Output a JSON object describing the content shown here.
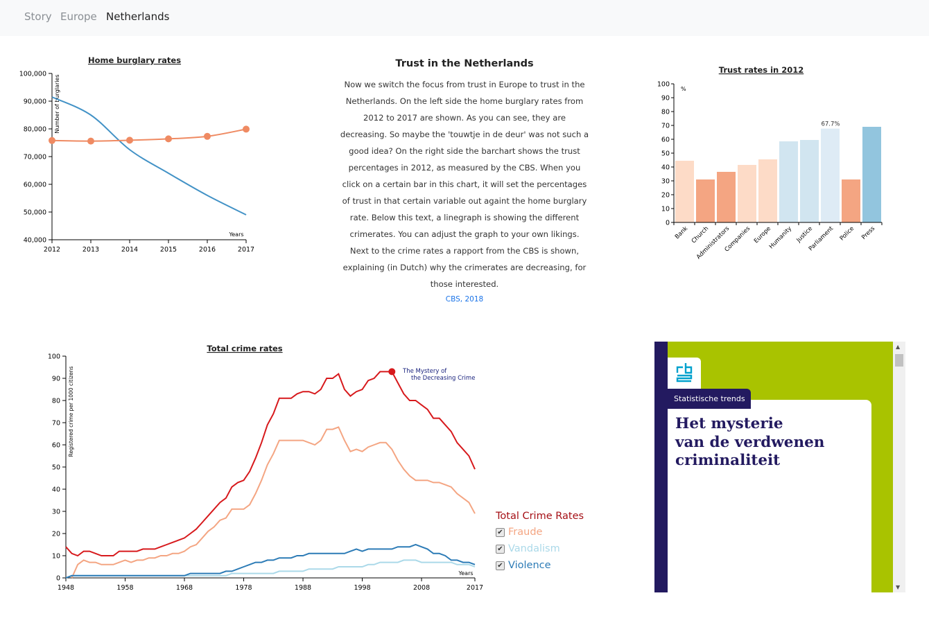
{
  "nav": {
    "items": [
      {
        "label": "Story"
      },
      {
        "label": "Europe"
      },
      {
        "label": "Netherlands"
      }
    ]
  },
  "intro": {
    "title": "Trust in the Netherlands",
    "text": "Now we switch the focus from trust in Europe to trust in the Netherlands. On the left side the home burglary rates from 2012 to 2017 are shown. As you can see, they are decreasing. So maybe the 'touwtje in de deur' was not such a good idea? On the right side the barchart shows the trust percentages in 2012, as measured by the CBS. When you click on a certain bar in this chart, it will set the percentages of trust in that certain variable out againt the home burglary rate. Below this text, a linegraph is showing the different crimerates. You can adjust the graph to your own likings. Next to the crime rates a rapport from the CBS is shown, explaining (in Dutch) why the crimerates are decreasing, for those interested.",
    "link": "CBS, 2018"
  },
  "chart_data": [
    {
      "type": "line",
      "title": "Home burglary rates",
      "ylabel": "Number of burglaries",
      "xlabel": "Years",
      "x": [
        2012,
        2013,
        2014,
        2015,
        2016,
        2017
      ],
      "xticks": [
        "2012",
        "2013",
        "2014",
        "2015",
        "2016",
        "2017"
      ],
      "yticks": [
        "40,000",
        "50,000",
        "60,000",
        "70,000",
        "80,000",
        "90,000",
        "100,000"
      ],
      "ylim": [
        40000,
        100000
      ],
      "series": [
        {
          "values": [
            91500,
            85000,
            72500,
            64000,
            56000,
            49000
          ],
          "color": "#4292c6",
          "markers": false
        },
        {
          "values": [
            75800,
            75600,
            75900,
            76400,
            77300,
            79900
          ],
          "color": "#ef8a62",
          "markers": true
        }
      ]
    },
    {
      "type": "bar",
      "title": "Trust rates in 2012",
      "ylabel": "%",
      "categories": [
        "Bank",
        "Church",
        "Administrators",
        "Companies",
        "Europe",
        "Humanity",
        "Justice",
        "Parliament",
        "Police",
        "Press"
      ],
      "values": [
        44.5,
        31,
        36.5,
        41.5,
        45.5,
        58.5,
        59.5,
        67.7,
        31,
        69
      ],
      "colors": [
        "#fddbc7",
        "#f4a582",
        "#f4a582",
        "#fddbc7",
        "#fddbc7",
        "#d1e5f0",
        "#d1e5f0",
        "#deebf5",
        "#f4a582",
        "#92c5de"
      ],
      "highlight_label": "67.7%",
      "highlight_index": 7,
      "yticks": [
        "0",
        "10",
        "20",
        "30",
        "40",
        "50",
        "60",
        "70",
        "80",
        "90",
        "100"
      ],
      "ylim": [
        0,
        100
      ]
    },
    {
      "type": "line",
      "title": "Total crime rates",
      "ylabel": "Registered crime per 1000 citizens",
      "xlabel": "Years",
      "xlim": [
        1948,
        2017
      ],
      "ylim": [
        0,
        100
      ],
      "xticks": [
        "1948",
        "1958",
        "1968",
        "1978",
        "1988",
        "1998",
        "2008",
        "2017"
      ],
      "yticks": [
        "0",
        "10",
        "20",
        "30",
        "40",
        "50",
        "60",
        "70",
        "80",
        "90",
        "100"
      ],
      "annotation": {
        "line1": "The Mystery of",
        "line2": "the Decreasing Crime",
        "x": 2003,
        "y": 93
      },
      "legend_title": "Total Crime Rates",
      "series": [
        {
          "name": "Total",
          "color": "#d7191c",
          "points": [
            [
              1948,
              14
            ],
            [
              1949,
              11
            ],
            [
              1950,
              10
            ],
            [
              1951,
              12
            ],
            [
              1952,
              12
            ],
            [
              1953,
              11
            ],
            [
              1954,
              10
            ],
            [
              1955,
              10
            ],
            [
              1956,
              10
            ],
            [
              1957,
              12
            ],
            [
              1958,
              12
            ],
            [
              1959,
              12
            ],
            [
              1960,
              12
            ],
            [
              1961,
              13
            ],
            [
              1962,
              13
            ],
            [
              1963,
              13
            ],
            [
              1964,
              14
            ],
            [
              1965,
              15
            ],
            [
              1966,
              16
            ],
            [
              1967,
              17
            ],
            [
              1968,
              18
            ],
            [
              1969,
              20
            ],
            [
              1970,
              22
            ],
            [
              1971,
              25
            ],
            [
              1972,
              28
            ],
            [
              1973,
              31
            ],
            [
              1974,
              34
            ],
            [
              1975,
              36
            ],
            [
              1976,
              41
            ],
            [
              1977,
              43
            ],
            [
              1978,
              44
            ],
            [
              1979,
              48
            ],
            [
              1980,
              54
            ],
            [
              1981,
              61
            ],
            [
              1982,
              69
            ],
            [
              1983,
              74
            ],
            [
              1984,
              81
            ],
            [
              1985,
              81
            ],
            [
              1986,
              81
            ],
            [
              1987,
              83
            ],
            [
              1988,
              84
            ],
            [
              1989,
              84
            ],
            [
              1990,
              83
            ],
            [
              1991,
              85
            ],
            [
              1992,
              90
            ],
            [
              1993,
              90
            ],
            [
              1994,
              92
            ],
            [
              1995,
              85
            ],
            [
              1996,
              82
            ],
            [
              1997,
              84
            ],
            [
              1998,
              85
            ],
            [
              1999,
              89
            ],
            [
              2000,
              90
            ],
            [
              2001,
              93
            ],
            [
              2002,
              93
            ],
            [
              2003,
              93
            ],
            [
              2004,
              88
            ],
            [
              2005,
              83
            ],
            [
              2006,
              80
            ],
            [
              2007,
              80
            ],
            [
              2008,
              78
            ],
            [
              2009,
              76
            ],
            [
              2010,
              72
            ],
            [
              2011,
              72
            ],
            [
              2012,
              69
            ],
            [
              2013,
              66
            ],
            [
              2014,
              61
            ],
            [
              2015,
              58
            ],
            [
              2016,
              55
            ],
            [
              2017,
              49
            ]
          ]
        },
        {
          "name": "Fraude",
          "color": "#f4a582",
          "checked": true,
          "points": [
            [
              1949,
              0
            ],
            [
              1950,
              6
            ],
            [
              1951,
              8
            ],
            [
              1952,
              7
            ],
            [
              1953,
              7
            ],
            [
              1954,
              6
            ],
            [
              1955,
              6
            ],
            [
              1956,
              6
            ],
            [
              1957,
              7
            ],
            [
              1958,
              8
            ],
            [
              1959,
              7
            ],
            [
              1960,
              8
            ],
            [
              1961,
              8
            ],
            [
              1962,
              9
            ],
            [
              1963,
              9
            ],
            [
              1964,
              10
            ],
            [
              1965,
              10
            ],
            [
              1966,
              11
            ],
            [
              1967,
              11
            ],
            [
              1968,
              12
            ],
            [
              1969,
              14
            ],
            [
              1970,
              15
            ],
            [
              1971,
              18
            ],
            [
              1972,
              21
            ],
            [
              1973,
              23
            ],
            [
              1974,
              26
            ],
            [
              1975,
              27
            ],
            [
              1976,
              31
            ],
            [
              1977,
              31
            ],
            [
              1978,
              31
            ],
            [
              1979,
              33
            ],
            [
              1980,
              38
            ],
            [
              1981,
              44
            ],
            [
              1982,
              51
            ],
            [
              1983,
              56
            ],
            [
              1984,
              62
            ],
            [
              1985,
              62
            ],
            [
              1986,
              62
            ],
            [
              1987,
              62
            ],
            [
              1988,
              62
            ],
            [
              1989,
              61
            ],
            [
              1990,
              60
            ],
            [
              1991,
              62
            ],
            [
              1992,
              67
            ],
            [
              1993,
              67
            ],
            [
              1994,
              68
            ],
            [
              1995,
              62
            ],
            [
              1996,
              57
            ],
            [
              1997,
              58
            ],
            [
              1998,
              57
            ],
            [
              1999,
              59
            ],
            [
              2000,
              60
            ],
            [
              2001,
              61
            ],
            [
              2002,
              61
            ],
            [
              2003,
              58
            ],
            [
              2004,
              53
            ],
            [
              2005,
              49
            ],
            [
              2006,
              46
            ],
            [
              2007,
              44
            ],
            [
              2008,
              44
            ],
            [
              2009,
              44
            ],
            [
              2010,
              43
            ],
            [
              2011,
              43
            ],
            [
              2012,
              42
            ],
            [
              2013,
              41
            ],
            [
              2014,
              38
            ],
            [
              2015,
              36
            ],
            [
              2016,
              34
            ],
            [
              2017,
              29
            ]
          ]
        },
        {
          "name": "Vandalism",
          "color": "#abd9e9",
          "checked": true,
          "points": [
            [
              1948,
              0
            ],
            [
              1949,
              1
            ],
            [
              1955,
              1
            ],
            [
              1960,
              1
            ],
            [
              1965,
              1
            ],
            [
              1970,
              1
            ],
            [
              1975,
              1
            ],
            [
              1976,
              2
            ],
            [
              1980,
              2
            ],
            [
              1983,
              2
            ],
            [
              1984,
              3
            ],
            [
              1987,
              3
            ],
            [
              1988,
              3
            ],
            [
              1989,
              4
            ],
            [
              1992,
              4
            ],
            [
              1993,
              4
            ],
            [
              1994,
              5
            ],
            [
              1998,
              5
            ],
            [
              1999,
              6
            ],
            [
              2000,
              6
            ],
            [
              2001,
              7
            ],
            [
              2003,
              7
            ],
            [
              2004,
              7
            ],
            [
              2005,
              8
            ],
            [
              2007,
              8
            ],
            [
              2008,
              7
            ],
            [
              2012,
              7
            ],
            [
              2013,
              7
            ],
            [
              2014,
              6
            ],
            [
              2016,
              6
            ],
            [
              2017,
              5
            ]
          ]
        },
        {
          "name": "Violence",
          "color": "#2c7bb6",
          "checked": true,
          "points": [
            [
              1948,
              0
            ],
            [
              1949,
              1
            ],
            [
              1955,
              1
            ],
            [
              1960,
              1
            ],
            [
              1965,
              1
            ],
            [
              1968,
              1
            ],
            [
              1969,
              2
            ],
            [
              1974,
              2
            ],
            [
              1975,
              3
            ],
            [
              1976,
              3
            ],
            [
              1977,
              4
            ],
            [
              1978,
              5
            ],
            [
              1979,
              6
            ],
            [
              1980,
              7
            ],
            [
              1981,
              7
            ],
            [
              1982,
              8
            ],
            [
              1983,
              8
            ],
            [
              1984,
              9
            ],
            [
              1985,
              9
            ],
            [
              1986,
              9
            ],
            [
              1987,
              10
            ],
            [
              1988,
              10
            ],
            [
              1989,
              11
            ],
            [
              1990,
              11
            ],
            [
              1991,
              11
            ],
            [
              1992,
              11
            ],
            [
              1993,
              11
            ],
            [
              1994,
              11
            ],
            [
              1995,
              11
            ],
            [
              1996,
              12
            ],
            [
              1997,
              13
            ],
            [
              1998,
              12
            ],
            [
              1999,
              13
            ],
            [
              2000,
              13
            ],
            [
              2001,
              13
            ],
            [
              2002,
              13
            ],
            [
              2003,
              13
            ],
            [
              2004,
              14
            ],
            [
              2005,
              14
            ],
            [
              2006,
              14
            ],
            [
              2007,
              15
            ],
            [
              2008,
              14
            ],
            [
              2009,
              13
            ],
            [
              2010,
              11
            ],
            [
              2011,
              11
            ],
            [
              2012,
              10
            ],
            [
              2013,
              8
            ],
            [
              2014,
              8
            ],
            [
              2015,
              7
            ],
            [
              2016,
              7
            ],
            [
              2017,
              6
            ]
          ]
        }
      ]
    }
  ],
  "report": {
    "tag": "Statistische trends",
    "title_line1": "Het mysterie",
    "title_line2": "van de verdwenen",
    "title_line3": "criminaliteit",
    "colors": {
      "green": "#a9c300",
      "navy": "#231a60",
      "logo_blue": "#00a1cd"
    }
  },
  "scrollbar": {
    "up": "▲",
    "down": "▼"
  },
  "check_mark": "✔"
}
